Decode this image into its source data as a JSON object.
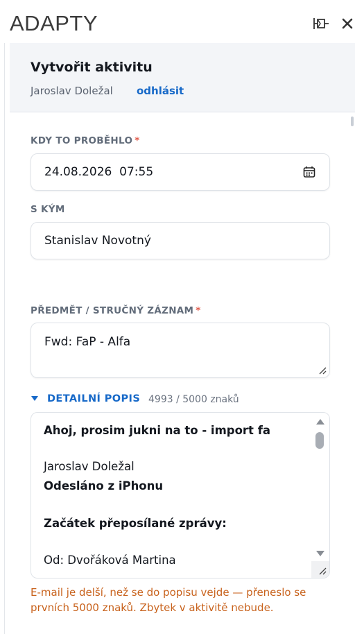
{
  "app": {
    "title": "ADAPTY"
  },
  "header": {
    "title": "Vytvořit aktivitu",
    "user": "Jaroslav Doležal",
    "logout": "odhlásit"
  },
  "form": {
    "when": {
      "label": "KDY TO PROBĚHLO",
      "required": "*",
      "value": "24.08.2026  07:55"
    },
    "with": {
      "label": "S KÝM",
      "value": "Stanislav Novotný"
    },
    "subject": {
      "label": "PŘEDMĚT / STRUČNÝ ZÁZNAM",
      "required": "*",
      "value": "Fwd: FaP - Alfa"
    },
    "detail": {
      "label": "DETAILNÍ POPIS",
      "count": "4993 / 5000 znaků",
      "lines": [
        "Ahoj, prosim jukni na to - import fa",
        "Jaroslav Doležal",
        "Odesláno z iPhonu",
        "Začátek přeposílané zprávy:",
        "Od: Dvořáková Martina"
      ]
    },
    "warning": "E-mail je delší, než se do popisu vejde — přeneslo se prvních 5000 znaků. Zbytek v aktivitě nebude."
  },
  "icons": {
    "pin": "pin-icon",
    "close": "close-icon",
    "calendar": "calendar-icon",
    "caret": "caret-down-icon"
  },
  "colors": {
    "accent": "#1769c8",
    "required": "#e05a4a",
    "warning": "#c8621c"
  }
}
